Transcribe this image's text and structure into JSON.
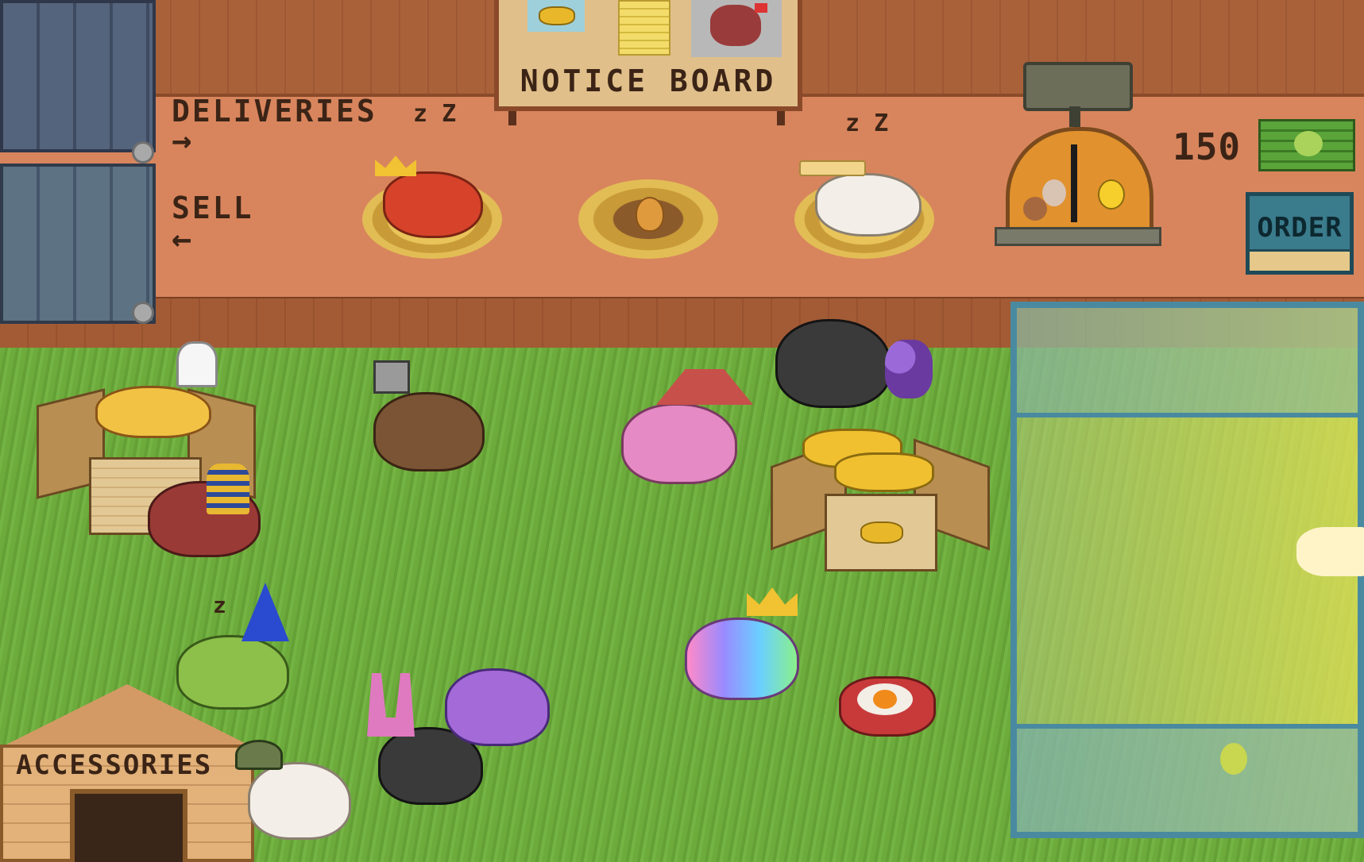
{
  "notice_board": {
    "title": "NOTICE BOARD"
  },
  "shelf": {
    "deliveries_label": "DELIVERIES",
    "deliveries_arrow": "→",
    "sell_label": "SELL",
    "sell_arrow": "←"
  },
  "nests": [
    {
      "occupant": "crowned orange hen",
      "sleeping": true,
      "sleep_text": "z Z"
    },
    {
      "occupant": "egg",
      "sleeping": false
    },
    {
      "occupant": "white hen with straw hat",
      "sleeping": true,
      "sleep_text": "z Z"
    }
  ],
  "money": {
    "amount": "150",
    "icon": "money-stack-icon"
  },
  "order_button": {
    "label": "ORDER"
  },
  "accessories_shed": {
    "label": "ACCESSORIES"
  },
  "wizard_sleep_text": "z",
  "colors": {
    "wall_top": "#a8623a",
    "shelf": "#d9845c",
    "grass": "#6aa83a",
    "order_button": "#3a7a8a",
    "money_green": "#4f8a2b"
  }
}
